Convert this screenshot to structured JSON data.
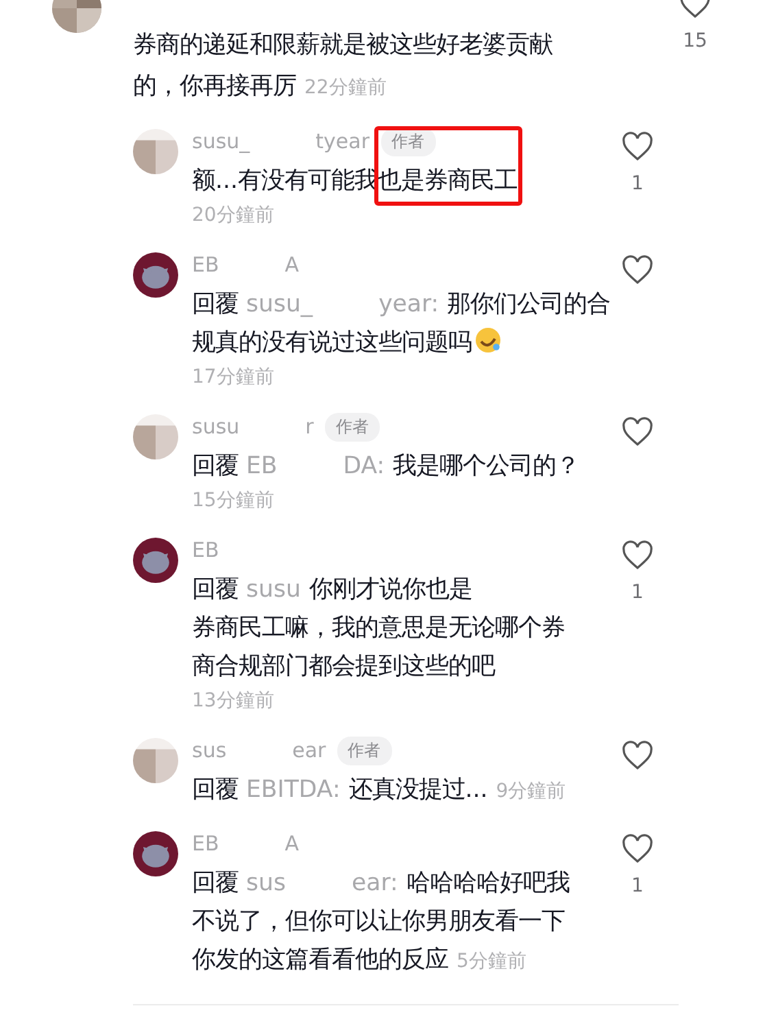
{
  "comments": [
    {
      "kind": "main",
      "avatar": {
        "kind": "photo"
      },
      "lines": [
        "券商的递延和限薪就是被这些好老婆贡献",
        "的，你再接再厉"
      ],
      "time": "22分鐘前",
      "time_inline": true,
      "likes": "15",
      "liked": false
    },
    {
      "kind": "reply",
      "avatar": {
        "kind": "pixel"
      },
      "author": [
        "susu_",
        "tyear"
      ],
      "badge": "作者",
      "lines": [
        "额...有没有可能我"
      ],
      "highlighted": "也是券商民工",
      "time": "20分鐘前",
      "time_inline": false,
      "likes": "1",
      "liked": false
    },
    {
      "kind": "reply",
      "avatar": {
        "kind": "maroon"
      },
      "author": [
        "EB",
        "A"
      ],
      "reply_label": "回覆",
      "mention": [
        "susu_",
        "year:"
      ],
      "lines": [
        "那你们公司的合",
        "规真的没有说过这些问题吗"
      ],
      "emoji": true,
      "time": "17分鐘前",
      "time_inline": false,
      "liked": false
    },
    {
      "kind": "reply",
      "avatar": {
        "kind": "pixel"
      },
      "author": [
        "susu",
        "r"
      ],
      "badge": "作者",
      "reply_label": "回覆",
      "mention": [
        "EB",
        "DA:"
      ],
      "lines": [
        "我是哪个公司的？"
      ],
      "time": "15分鐘前",
      "time_inline": false,
      "liked": false
    },
    {
      "kind": "reply",
      "avatar": {
        "kind": "maroon"
      },
      "author": [
        "EB"
      ],
      "reply_label": "回覆",
      "mention": [
        "susu"
      ],
      "lines": [
        "你刚才说你也是",
        "券商民工嘛，我的意思是无论哪个券",
        "商合规部门都会提到这些的吧"
      ],
      "time": "13分鐘前",
      "time_inline": false,
      "likes": "1",
      "liked": false
    },
    {
      "kind": "reply",
      "avatar": {
        "kind": "pixel"
      },
      "author": [
        "sus",
        "ear"
      ],
      "badge": "作者",
      "reply_label": "回覆",
      "mention": [
        "EBITDA:"
      ],
      "lines": [
        "还真没提过..."
      ],
      "time": "9分鐘前",
      "time_inline": true,
      "liked": false
    },
    {
      "kind": "reply",
      "avatar": {
        "kind": "maroon"
      },
      "author": [
        "EB",
        "A"
      ],
      "reply_label": "回覆",
      "mention": [
        "sus",
        "ear:"
      ],
      "lines": [
        "哈哈哈哈好吧我",
        "不说了，但你可以让你男朋友看一下",
        "你发的这篇看看他的反应"
      ],
      "time": "5分鐘前",
      "time_inline": true,
      "likes": "1",
      "liked": false
    }
  ]
}
